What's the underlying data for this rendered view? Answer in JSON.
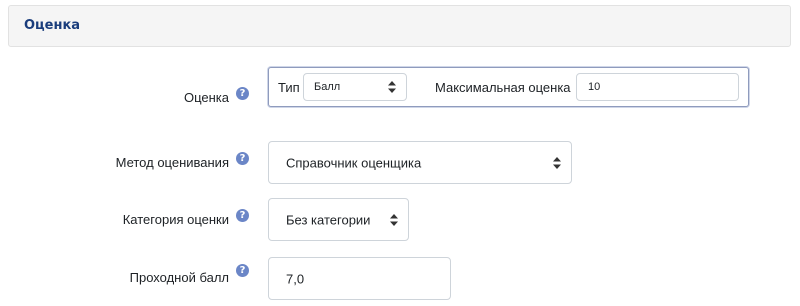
{
  "section": {
    "title": "Оценка"
  },
  "grade": {
    "label": "Оценка",
    "type_label": "Тип",
    "type_value": "Балл",
    "max_label": "Максимальная оценка",
    "max_value": "10"
  },
  "method": {
    "label": "Метод оценивания",
    "value": "Справочник оценщика"
  },
  "category": {
    "label": "Категория оценки",
    "value": "Без категории"
  },
  "pass": {
    "label": "Проходной балл",
    "value": "7,0"
  },
  "icons": {
    "help": "question-circle-icon",
    "select_arrows": "sort-arrows-icon"
  },
  "colors": {
    "section_title": "#1a3d7c",
    "help_icon": "#6b86c7",
    "focus_border": "#8f9bbd"
  }
}
